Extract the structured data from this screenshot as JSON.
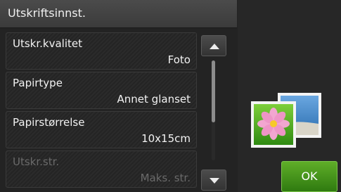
{
  "header": {
    "title": "Utskriftsinnst."
  },
  "settings": [
    {
      "label": "Utskr.kvalitet",
      "value": "Foto",
      "enabled": true
    },
    {
      "label": "Papirtype",
      "value": "Annet glanset",
      "enabled": true
    },
    {
      "label": "Papirstørrelse",
      "value": "10x15cm",
      "enabled": true
    },
    {
      "label": "Utskr.str.",
      "value": "Maks. str.",
      "enabled": false
    }
  ],
  "scrollbar": {
    "up_icon": "arrow-up-icon",
    "down_icon": "arrow-down-icon"
  },
  "preview": {
    "icon": "photo-icon"
  },
  "ok_button": {
    "label": "OK",
    "color": "#4a9a1c"
  }
}
